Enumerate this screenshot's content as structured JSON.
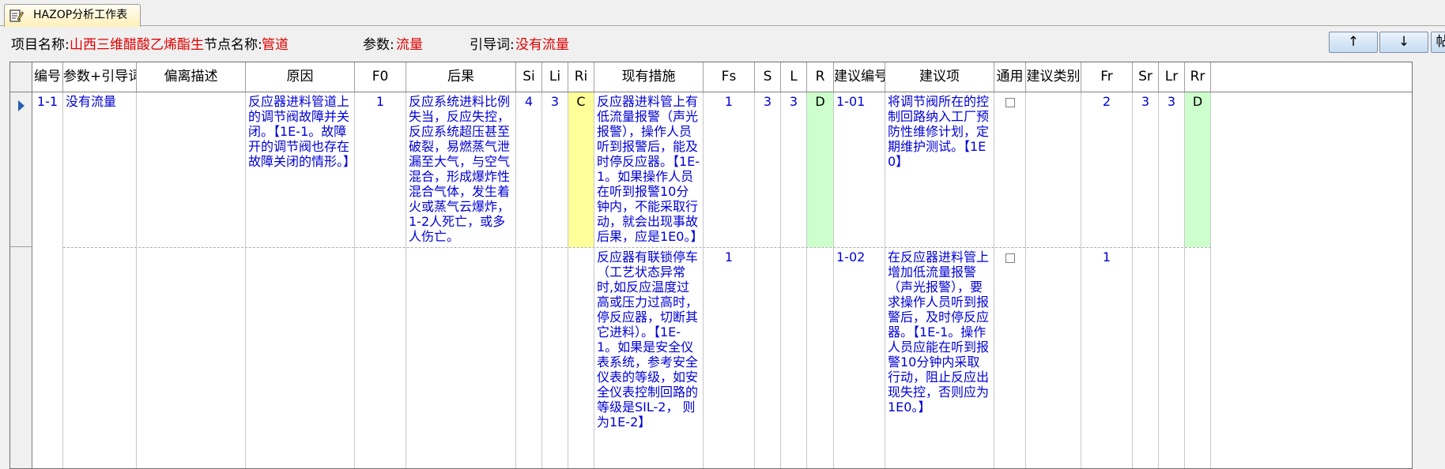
{
  "tab": {
    "title": "HAZOP分析工作表"
  },
  "info": {
    "project_label": "项目名称:",
    "project_value": "山西三维醋酸乙烯酯生产",
    "node_label": "节点名称:",
    "node_value": "管道",
    "param_label": "参数:",
    "param_value": "流量",
    "guide_label": "引导词:",
    "guide_value": "没有流量"
  },
  "nav": {
    "up": "↑",
    "down": "↓",
    "extra": "帖"
  },
  "colors": {
    "accent_red": "#e00000",
    "cell_blue": "#0000d8",
    "risk_yellow": "#ffff99",
    "risk_green": "#ccffcc"
  },
  "table": {
    "headers": {
      "id": "编号",
      "param": "参数+引导词",
      "dev": "偏离描述",
      "cause": "原因",
      "f0": "F0",
      "cons": "后果",
      "si": "Si",
      "li": "Li",
      "ri": "Ri",
      "meas": "现有措施",
      "fs": "Fs",
      "s": "S",
      "l": "L",
      "r": "R",
      "sug_id": "建议编号",
      "sug": "建议项",
      "gen": "通用",
      "cat": "建议类别",
      "fr": "Fr",
      "sr": "Sr",
      "lr": "Lr",
      "rr": "Rr"
    },
    "row": {
      "id": "1-1",
      "param": "没有流量",
      "dev": "",
      "cause": "反应器进料管道上的调节阀故障并关闭。【1E-1。故障开的调节阀也存在故障关闭的情形。】",
      "f0": "1",
      "cons": "反应系统进料比例失当，反应失控，反应系统超压甚至破裂，易燃蒸气泄漏至大气，与空气混合，形成爆炸性混合气体，发生着火或蒸气云爆炸，1-2人死亡，或多人伤亡。",
      "si": "4",
      "li": "3",
      "ri": "C",
      "measures": [
        {
          "text": "反应器进料管上有低流量报警（声光报警），操作人员听到报警后，能及时停反应器。【1E-1。如果操作人员在听到报警10分钟内，不能采取行动，就会出现事故后果，应是1E0。】",
          "fs": "1",
          "s": "3",
          "l": "3",
          "r": "D"
        },
        {
          "text": "反应器有联锁停车（工艺状态异常时,如反应温度过高或压力过高时，停反应器，切断其它进料）。【1E-1。如果是安全仪表系统，参考安全仪表的等级，如安全仪表控制回路的等级是SIL-2， 则为1E-2】",
          "fs": "1",
          "s": "",
          "l": "",
          "r": ""
        }
      ],
      "suggestions": [
        {
          "id": "1-01",
          "text": "将调节阀所在的控制回路纳入工厂预防性维修计划，定期维护测试。【1E0】",
          "general": false,
          "category": "",
          "fr": "2",
          "sr": "3",
          "lr": "3",
          "rr": "D"
        },
        {
          "id": "1-02",
          "text": "在反应器进料管上增加低流量报警（声光报警），要求操作人员听到报警后，及时停反应器。【1E-1。操作人员应能在听到报警10分钟内采取行动，阻止反应出现失控，否则应为1E0。】",
          "general": false,
          "category": "",
          "fr": "1",
          "sr": "",
          "lr": "",
          "rr": ""
        }
      ]
    }
  }
}
